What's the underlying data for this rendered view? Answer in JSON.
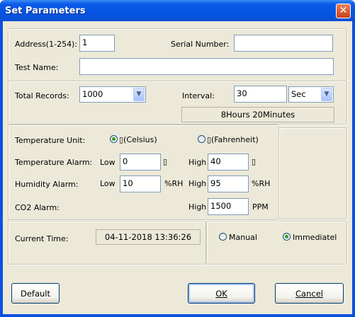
{
  "window": {
    "title": "Set Parameters",
    "close_label": "✕"
  },
  "device": {
    "address_label": "Address(1-254):",
    "address_value": "1",
    "serial_label": "Serial Number:",
    "serial_value": "",
    "test_name_label": "Test Name:",
    "test_name_value": ""
  },
  "records": {
    "total_label": "Total Records:",
    "total_value": "1000",
    "interval_label": "Interval:",
    "interval_value": "30",
    "interval_unit": "Sec",
    "duration": "8Hours 20Minutes"
  },
  "alarms": {
    "temp_unit_label": "Temperature Unit:",
    "celsius_label": "▯(Celsius)",
    "fahrenheit_label": "▯(Fahrenheit)",
    "temp_alarm_label": "Temperature Alarm:",
    "humidity_alarm_label": "Humidity Alarm:",
    "co2_alarm_label": "CO2 Alarm:",
    "low_label": "Low",
    "high_label": "High",
    "temp_low": "0",
    "temp_high": "40",
    "temp_unit_glyph": "▯",
    "hum_low": "10",
    "hum_high": "95",
    "hum_unit": "%RH",
    "co2_high": "1500",
    "co2_unit": "PPM"
  },
  "time": {
    "current_label": "Current Time:",
    "current_value": "04-11-2018 13:36:26",
    "manual_label": "Manual",
    "immediate_label": "Immediatel"
  },
  "buttons": {
    "default_label": "Default",
    "ok_label": "OK",
    "cancel_label": "Cancel"
  }
}
